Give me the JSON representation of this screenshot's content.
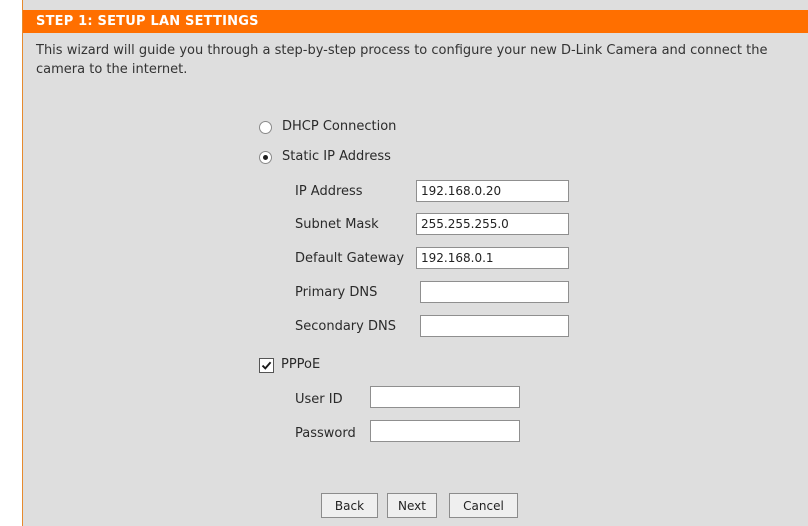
{
  "header": {
    "title": "STEP 1: SETUP LAN SETTINGS"
  },
  "intro_text": "This wizard will guide you through a step-by-step process to configure your new D-Link Camera and connect the camera to the internet.",
  "connection": {
    "dhcp_label": "DHCP Connection",
    "static_label": "Static IP Address",
    "selected": "static"
  },
  "static_fields": {
    "ip_address": {
      "label": "IP Address",
      "value": "192.168.0.20"
    },
    "subnet_mask": {
      "label": "Subnet Mask",
      "value": "255.255.255.0"
    },
    "default_gateway": {
      "label": "Default Gateway",
      "value": "192.168.0.1"
    },
    "primary_dns": {
      "label": "Primary DNS",
      "value": ""
    },
    "secondary_dns": {
      "label": "Secondary DNS",
      "value": ""
    }
  },
  "pppoe": {
    "label": "PPPoE",
    "checked": true,
    "user_id": {
      "label": "User ID",
      "value": ""
    },
    "password": {
      "label": "Password",
      "value": ""
    }
  },
  "buttons": {
    "back": "Back",
    "next": "Next",
    "cancel": "Cancel"
  },
  "colors": {
    "title_bar": "#ff6f00",
    "panel_background": "#dedede"
  }
}
